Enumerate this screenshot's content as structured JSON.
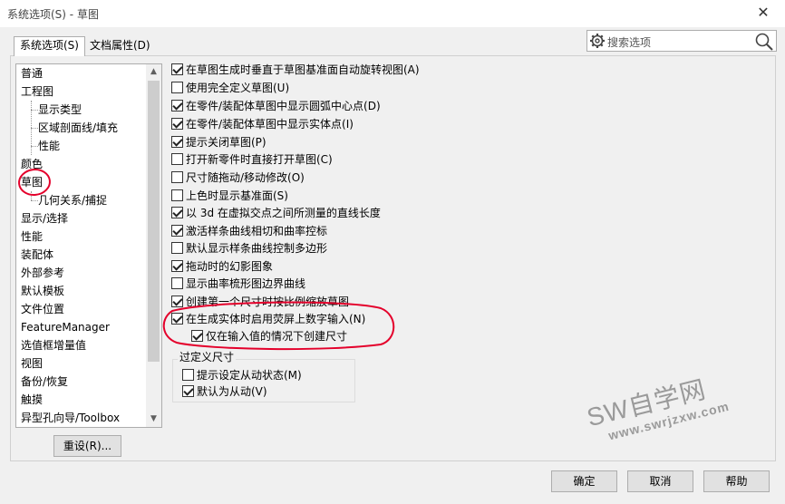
{
  "window": {
    "title": "系统选项(S) - 草图",
    "close_glyph": "✕"
  },
  "tabs": [
    {
      "label": "系统选项(S)",
      "active": true
    },
    {
      "label": "文档属性(D)",
      "active": false
    }
  ],
  "search": {
    "placeholder": "搜索选项",
    "icon_left": "gear-icon",
    "icon_right": "search-icon"
  },
  "tree": {
    "items": [
      {
        "label": "普通",
        "level": 0
      },
      {
        "label": "工程图",
        "level": 0
      },
      {
        "label": "显示类型",
        "level": 1
      },
      {
        "label": "区域剖面线/填充",
        "level": 1
      },
      {
        "label": "性能",
        "level": 1
      },
      {
        "label": "颜色",
        "level": 0
      },
      {
        "label": "草图",
        "level": 0,
        "selected": true
      },
      {
        "label": "几何关系/捕捉",
        "level": 1
      },
      {
        "label": "显示/选择",
        "level": 0
      },
      {
        "label": "性能",
        "level": 0
      },
      {
        "label": "装配体",
        "level": 0
      },
      {
        "label": "外部参考",
        "level": 0
      },
      {
        "label": "默认模板",
        "level": 0
      },
      {
        "label": "文件位置",
        "level": 0
      },
      {
        "label": "FeatureManager",
        "level": 0
      },
      {
        "label": "选值框增量值",
        "level": 0
      },
      {
        "label": "视图",
        "level": 0
      },
      {
        "label": "备份/恢复",
        "level": 0
      },
      {
        "label": "触摸",
        "level": 0
      },
      {
        "label": "异型孔向导/Toolbox",
        "level": 0
      }
    ],
    "scroll_up_glyph": "▲",
    "scroll_down_glyph": "▼"
  },
  "reset_button": "重设(R)...",
  "options": [
    {
      "label": "在草图生成时垂直于草图基准面自动旋转视图(A)",
      "checked": true
    },
    {
      "label": "使用完全定义草图(U)",
      "checked": false
    },
    {
      "label": "在零件/装配体草图中显示圆弧中心点(D)",
      "checked": true
    },
    {
      "label": "在零件/装配体草图中显示实体点(I)",
      "checked": true
    },
    {
      "label": "提示关闭草图(P)",
      "checked": true
    },
    {
      "label": "打开新零件时直接打开草图(C)",
      "checked": false
    },
    {
      "label": "尺寸随拖动/移动修改(O)",
      "checked": false
    },
    {
      "label": "上色时显示基准面(S)",
      "checked": false
    },
    {
      "label": "以 3d 在虚拟交点之间所测量的直线长度",
      "checked": true
    },
    {
      "label": "激活样条曲线相切和曲率控标",
      "checked": true
    },
    {
      "label": "默认显示样条曲线控制多边形",
      "checked": false
    },
    {
      "label": "拖动时的幻影图象",
      "checked": true
    },
    {
      "label": "显示曲率梳形图边界曲线",
      "checked": false
    },
    {
      "label": "创建第一个尺寸时按比例缩放草图",
      "checked": true
    },
    {
      "label": "在生成实体时启用荧屏上数字输入(N)",
      "checked": true
    }
  ],
  "sub_option": {
    "label": "仅在输入值的情况下创建尺寸",
    "checked": true
  },
  "overdefine": {
    "title": "过定义尺寸",
    "options": [
      {
        "label": "提示设定从动状态(M)",
        "checked": false
      },
      {
        "label": "默认为从动(V)",
        "checked": true
      }
    ]
  },
  "buttons": {
    "ok": "确定",
    "cancel": "取消",
    "help": "帮助"
  },
  "watermark": {
    "big": "SW自学网",
    "small": "www.swrjzxw.com"
  },
  "colors": {
    "annotation": "#e4002b",
    "watermark": "#9a9a9a"
  }
}
